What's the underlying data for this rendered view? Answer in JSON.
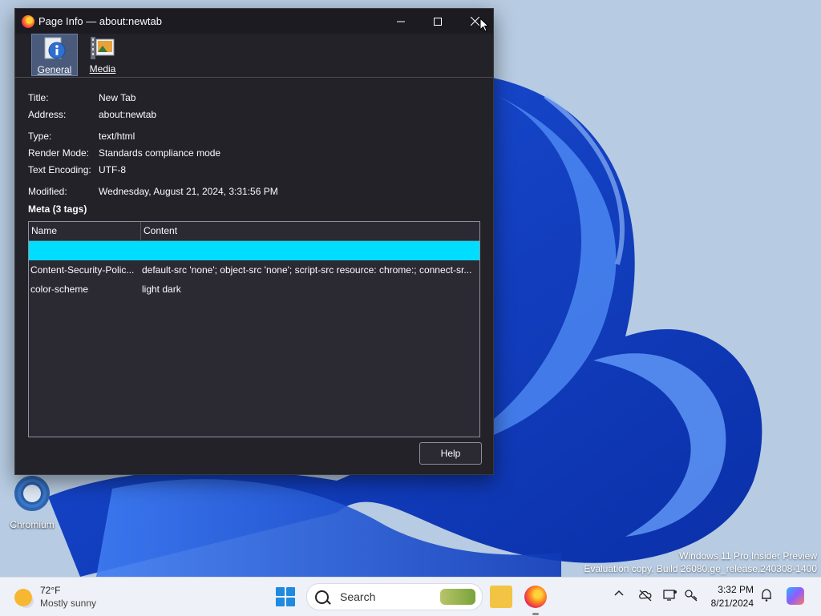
{
  "window": {
    "title": "Page Info — about:newtab",
    "controls": {
      "minimize": "minimize-icon",
      "maximize": "maximize-icon",
      "close": "close-icon"
    }
  },
  "toolbar": {
    "general_label": "General",
    "media_label": "Media"
  },
  "general": {
    "fields": [
      {
        "label": "Title:",
        "value": "New Tab"
      },
      {
        "label": "Address:",
        "value": "about:newtab"
      },
      {
        "label": "Type:",
        "value": "text/html"
      },
      {
        "label": "Render Mode:",
        "value": "Standards compliance mode"
      },
      {
        "label": "Text Encoding:",
        "value": "UTF-8"
      },
      {
        "label": "Modified:",
        "value": "Wednesday, August 21, 2024, 3:31:56 PM"
      }
    ],
    "meta_heading": "Meta (3 tags)",
    "meta_table": {
      "columns": [
        "Name",
        "Content"
      ],
      "rows": [
        {
          "name": "",
          "content": "",
          "selected": true
        },
        {
          "name": "Content-Security-Polic...",
          "content": "default-src 'none'; object-src 'none'; script-src resource: chrome:; connect-sr...",
          "selected": false
        },
        {
          "name": "color-scheme",
          "content": "light dark",
          "selected": false
        }
      ]
    },
    "help_label": "Help"
  },
  "desktop": {
    "chromium_label": "Chromium",
    "watermark_line1": "Windows 11 Pro Insider Preview",
    "watermark_line2": "Evaluation copy. Build 26080.ge_release.240308-1400"
  },
  "taskbar": {
    "weather_temp": "72°F",
    "weather_condition": "Mostly sunny",
    "search_label": "Search",
    "time": "3:32 PM",
    "date": "8/21/2024"
  },
  "colors": {
    "selection": "#00ddff",
    "window_bg": "#232228",
    "accent": "#1f8ae0"
  }
}
